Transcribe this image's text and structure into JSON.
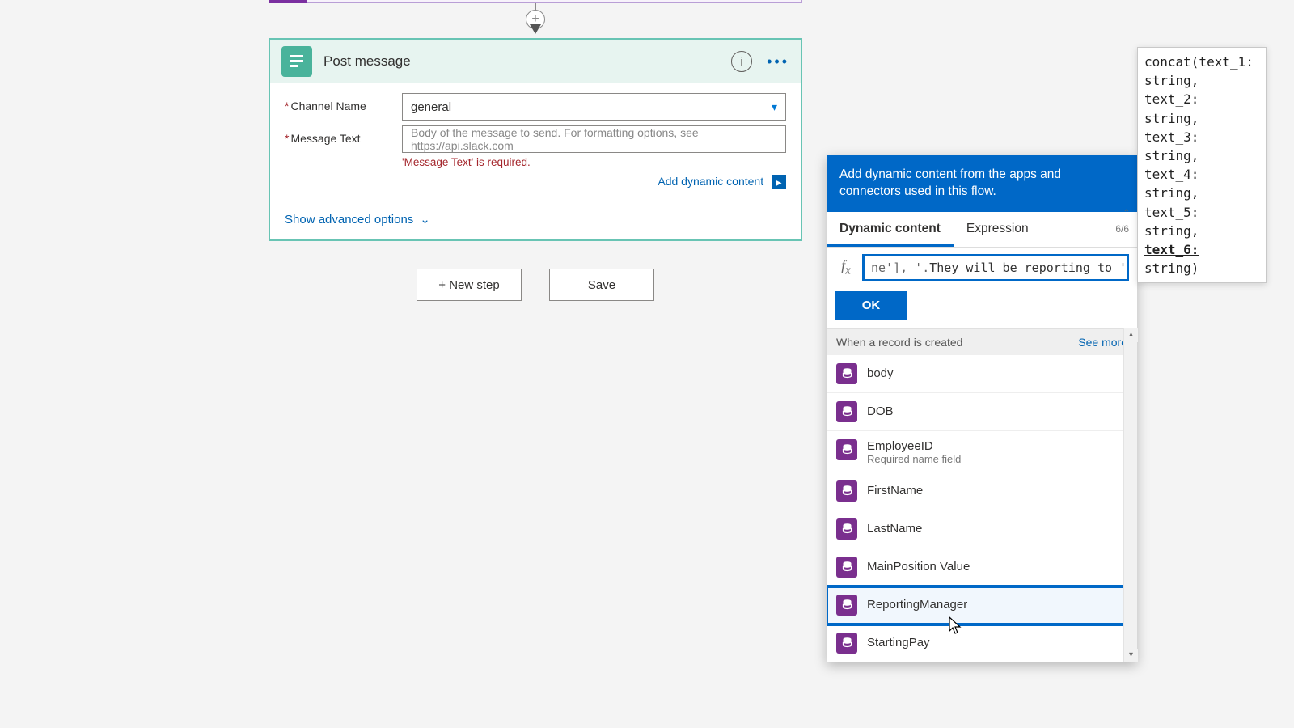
{
  "prev_step": {
    "visible_edge": true
  },
  "card": {
    "title": "Post message",
    "fields": {
      "channel": {
        "label": "Channel Name",
        "required": true,
        "value": "general"
      },
      "message": {
        "label": "Message Text",
        "required": true,
        "placeholder": "Body of the message to send. For formatting options, see https://api.slack.com",
        "error": "'Message Text' is required."
      }
    },
    "dynamic_link": "Add dynamic content",
    "advanced_link": "Show advanced options"
  },
  "buttons": {
    "new_step": "+ New step",
    "save": "Save"
  },
  "flyout": {
    "header": "Add dynamic content from the apps and connectors used in this flow.",
    "tabs": {
      "dynamic": "Dynamic content",
      "expression": "Expression",
      "active": "dynamic"
    },
    "page_indicator": "6/6",
    "expression_prefix": "ne'], '.",
    "expression_value": "They will be reporting to ', )",
    "ok": "OK",
    "section": {
      "title": "When a record is created",
      "see_more": "See more"
    },
    "items": [
      {
        "label": "body"
      },
      {
        "label": "DOB"
      },
      {
        "label": "EmployeeID",
        "sub": "Required name field"
      },
      {
        "label": "FirstName"
      },
      {
        "label": "LastName"
      },
      {
        "label": "MainPosition Value"
      },
      {
        "label": "ReportingManager",
        "highlight": true
      },
      {
        "label": "StartingPay"
      }
    ]
  },
  "autocomplete": {
    "lines": [
      "concat(text_1:",
      "string,",
      "text_2:",
      "string,",
      "text_3:",
      "string,",
      "text_4:",
      "string,",
      "text_5:",
      "string,",
      "text_6:",
      "string)"
    ],
    "selected_index": 10
  }
}
